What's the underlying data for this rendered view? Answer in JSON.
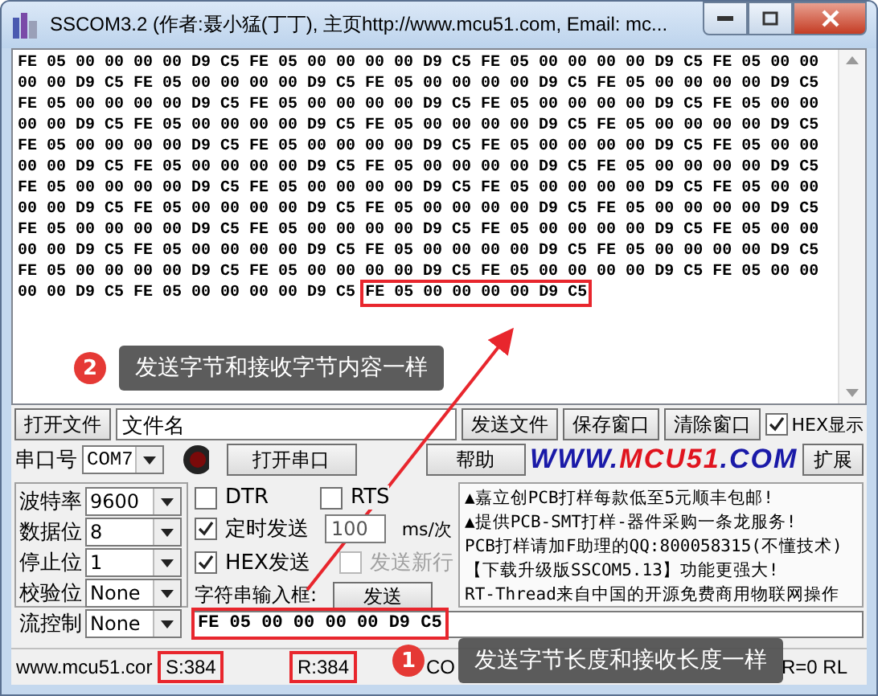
{
  "window": {
    "title": "SSCOM3.2 (作者:聂小猛(丁丁), 主页http://www.mcu51.com,  Email: mc..."
  },
  "receive": {
    "lines": [
      "FE 05 00 00 00 00 D9 C5 FE 05 00 00 00 00 D9 C5 FE 05 00 00 00 00 D9 C5 FE 05 00 00",
      "00 00 D9 C5 FE 05 00 00 00 00 D9 C5 FE 05 00 00 00 00 D9 C5 FE 05 00 00 00 00 D9 C5",
      "FE 05 00 00 00 00 D9 C5 FE 05 00 00 00 00 D9 C5 FE 05 00 00 00 00 D9 C5 FE 05 00 00",
      "00 00 D9 C5 FE 05 00 00 00 00 D9 C5 FE 05 00 00 00 00 D9 C5 FE 05 00 00 00 00 D9 C5",
      "FE 05 00 00 00 00 D9 C5 FE 05 00 00 00 00 D9 C5 FE 05 00 00 00 00 D9 C5 FE 05 00 00",
      "00 00 D9 C5 FE 05 00 00 00 00 D9 C5 FE 05 00 00 00 00 D9 C5 FE 05 00 00 00 00 D9 C5",
      "FE 05 00 00 00 00 D9 C5 FE 05 00 00 00 00 D9 C5 FE 05 00 00 00 00 D9 C5 FE 05 00 00",
      "00 00 D9 C5 FE 05 00 00 00 00 D9 C5 FE 05 00 00 00 00 D9 C5 FE 05 00 00 00 00 D9 C5",
      "FE 05 00 00 00 00 D9 C5 FE 05 00 00 00 00 D9 C5 FE 05 00 00 00 00 D9 C5 FE 05 00 00",
      "00 00 D9 C5 FE 05 00 00 00 00 D9 C5 FE 05 00 00 00 00 D9 C5 FE 05 00 00 00 00 D9 C5",
      "FE 05 00 00 00 00 D9 C5 FE 05 00 00 00 00 D9 C5 FE 05 00 00 00 00 D9 C5 FE 05 00 00"
    ],
    "last_line": "00 00 D9 C5 FE 05 00 00 00 00 D9 C5",
    "last_highlighted": "FE 05 00 00 00 00 D9 C5"
  },
  "toolbar1": {
    "open_file": "打开文件",
    "file_name": "文件名",
    "send_file": "发送文件",
    "save_window": "保存窗口",
    "clear_window": "清除窗口",
    "hex_display": {
      "label": "HEX显示",
      "checked": true
    }
  },
  "toolbar2": {
    "port_label": "串口号",
    "port": "COM7",
    "port_open": false,
    "open_port": "打开串口",
    "help": "帮助",
    "logo": [
      {
        "text": "WWW.",
        "color": "#1a1aa8"
      },
      {
        "text": "MCU51",
        "color": "#e0141e"
      },
      {
        "text": ".COM",
        "color": "#1a1aa8"
      }
    ],
    "expand": "扩展"
  },
  "settings": [
    {
      "label": "波特率",
      "value": "9600"
    },
    {
      "label": "数据位",
      "value": "8"
    },
    {
      "label": "停止位",
      "value": "1"
    },
    {
      "label": "校验位",
      "value": "None"
    },
    {
      "label": "流控制",
      "value": "None"
    }
  ],
  "options": {
    "dtr": {
      "label": "DTR",
      "checked": false
    },
    "rts": {
      "label": "RTS",
      "checked": false
    },
    "timed_send": {
      "label": "定时发送",
      "checked": true
    },
    "interval": "100",
    "unit": "ms/次",
    "hex_send": {
      "label": "HEX发送",
      "checked": true
    },
    "send_newline": {
      "label": "发送新行",
      "checked": false,
      "disabled": true
    },
    "input_label": "字符串输入框:",
    "send": "发送"
  },
  "ads": [
    "▲嘉立创PCB打样每款低至5元顺丰包邮!",
    "▲提供PCB-SMT打样-器件采购一条龙服务!",
    "PCB打样请加F助理的QQ:800058315(不懂技术)",
    "【下载升级版SSCOM5.13】功能更强大!",
    "RT-Thread来自中国的开源免费商用物联网操作"
  ],
  "send_input": {
    "value": "FE 05 00 00 00 00 D9 C5",
    "highlighted": true
  },
  "status": {
    "site": "www.mcu51.cor",
    "sent": {
      "text": "S:384",
      "highlighted": true
    },
    "received": {
      "text": "R:384",
      "highlighted": true
    },
    "port_fragment": "CO",
    "lines_fragment": "R=0 RL"
  },
  "callouts": [
    {
      "number": "2",
      "text": "发送字节和接收字节内容一样"
    },
    {
      "number": "1",
      "text": "发送字节长度和接收长度一样"
    }
  ]
}
